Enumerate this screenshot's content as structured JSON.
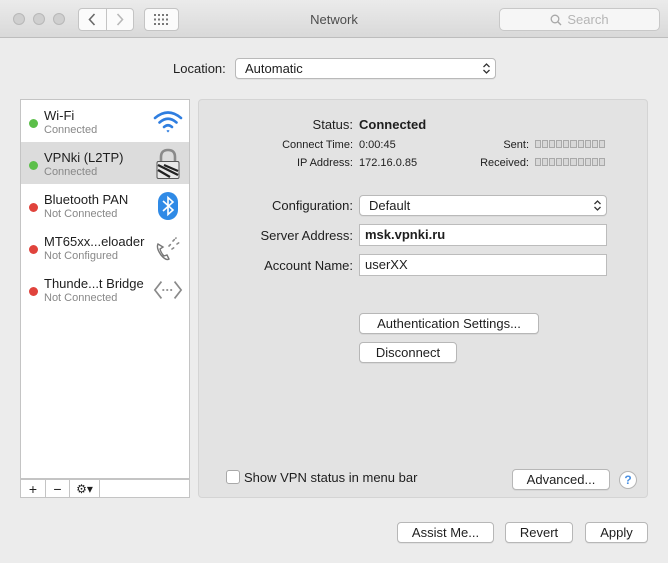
{
  "window": {
    "title": "Network"
  },
  "search": {
    "placeholder": "Search"
  },
  "location": {
    "label": "Location:",
    "value": "Automatic"
  },
  "services": [
    {
      "name": "Wi-Fi",
      "status": "Connected",
      "status_color": "#5cbf4a",
      "icon": "wifi-icon"
    },
    {
      "name": "VPNki (L2TP)",
      "status": "Connected",
      "status_color": "#5cbf4a",
      "icon": "vpn-lock-icon",
      "selected": true
    },
    {
      "name": "Bluetooth PAN",
      "status": "Not Connected",
      "status_color": "#e0433c",
      "icon": "bluetooth-icon"
    },
    {
      "name": "MT65xx...eloader",
      "status": "Not Configured",
      "status_color": "#e0433c",
      "icon": "phone-icon"
    },
    {
      "name": "Thunde...t Bridge",
      "status": "Not Connected",
      "status_color": "#e0433c",
      "icon": "thunderbolt-bridge-icon"
    }
  ],
  "sidebar_tools": {
    "add": "+",
    "remove": "−",
    "gear": "⚙▾"
  },
  "detail": {
    "status_label": "Status:",
    "status_value": "Connected",
    "connect_time_label": "Connect Time:",
    "connect_time_value": "0:00:45",
    "ip_label": "IP Address:",
    "ip_value": "172.16.0.85",
    "sent_label": "Sent:",
    "received_label": "Received:",
    "configuration_label": "Configuration:",
    "configuration_value": "Default",
    "server_label": "Server Address:",
    "server_value": "msk.vpnki.ru",
    "account_label": "Account Name:",
    "account_value": "userXX",
    "auth_button": "Authentication Settings...",
    "disconnect_button": "Disconnect",
    "show_vpn_label": "Show VPN status in menu bar",
    "advanced_button": "Advanced...",
    "help": "?"
  },
  "footer": {
    "assist": "Assist Me...",
    "revert": "Revert",
    "apply": "Apply"
  },
  "colors": {
    "connected": "#5cbf4a",
    "not_connected": "#e0433c",
    "accent": "#2f7ee0"
  }
}
